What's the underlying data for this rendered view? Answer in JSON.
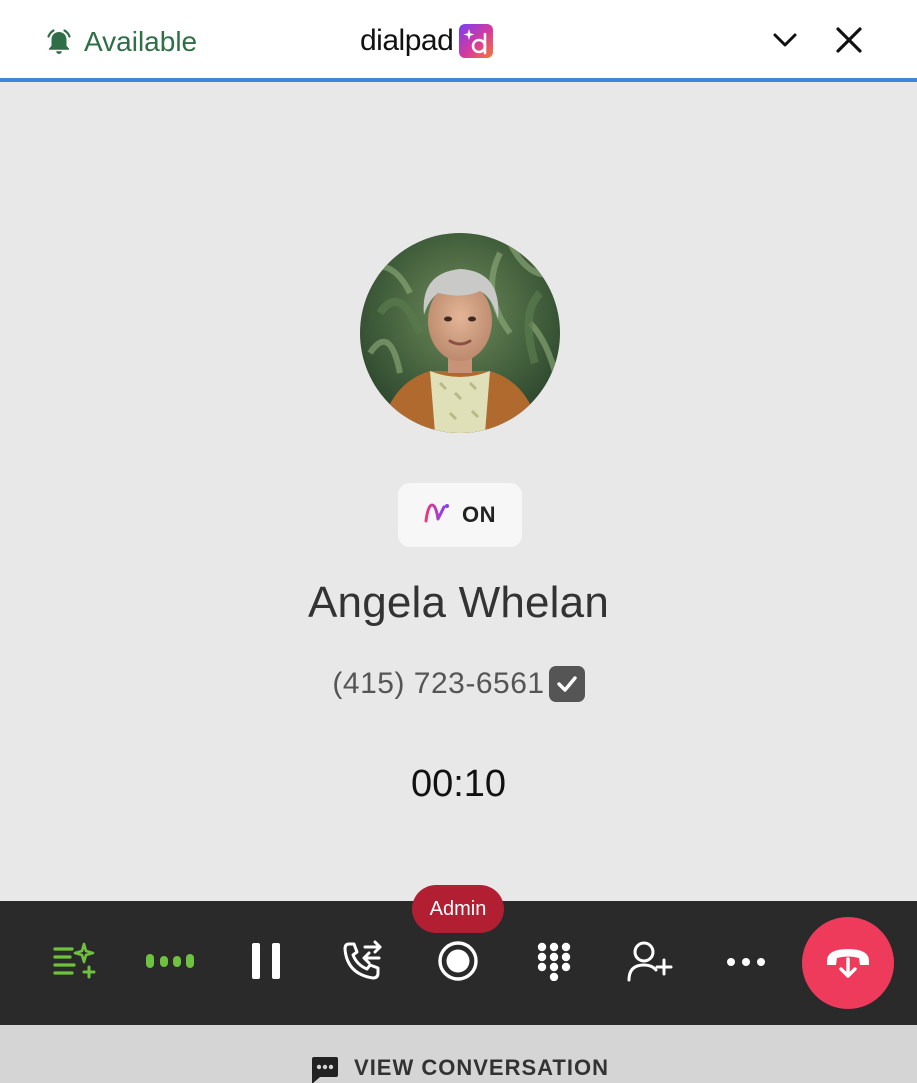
{
  "header": {
    "status_label": "Available",
    "brand_name": "dialpad",
    "collapse_icon": "chevron-down-icon",
    "close_icon": "close-icon",
    "status_color": "#2f6e47",
    "accent_color": "#3f86d8"
  },
  "call": {
    "ai_label": "ON",
    "contact_name": "Angela Whelan",
    "phone_number": "(415) 723-6561",
    "timer": "00:10"
  },
  "tooltip": {
    "label": "Admin"
  },
  "toolbar": {
    "buttons": [
      {
        "name": "ai-notes",
        "icon": "ai-notes-icon"
      },
      {
        "name": "live-transcript",
        "icon": "audio-dots-icon"
      },
      {
        "name": "hold",
        "icon": "pause-icon"
      },
      {
        "name": "transfer",
        "icon": "phone-transfer-icon"
      },
      {
        "name": "record",
        "icon": "record-icon"
      },
      {
        "name": "keypad",
        "icon": "keypad-icon"
      },
      {
        "name": "add-participant",
        "icon": "add-person-icon"
      },
      {
        "name": "more",
        "icon": "more-icon"
      },
      {
        "name": "hang-up",
        "icon": "hang-up-icon"
      }
    ],
    "hangup_color": "#ee3b5b",
    "active_color": "#6fc23f"
  },
  "footer": {
    "label": "VIEW CONVERSATION",
    "icon": "chat-bubble-icon"
  }
}
